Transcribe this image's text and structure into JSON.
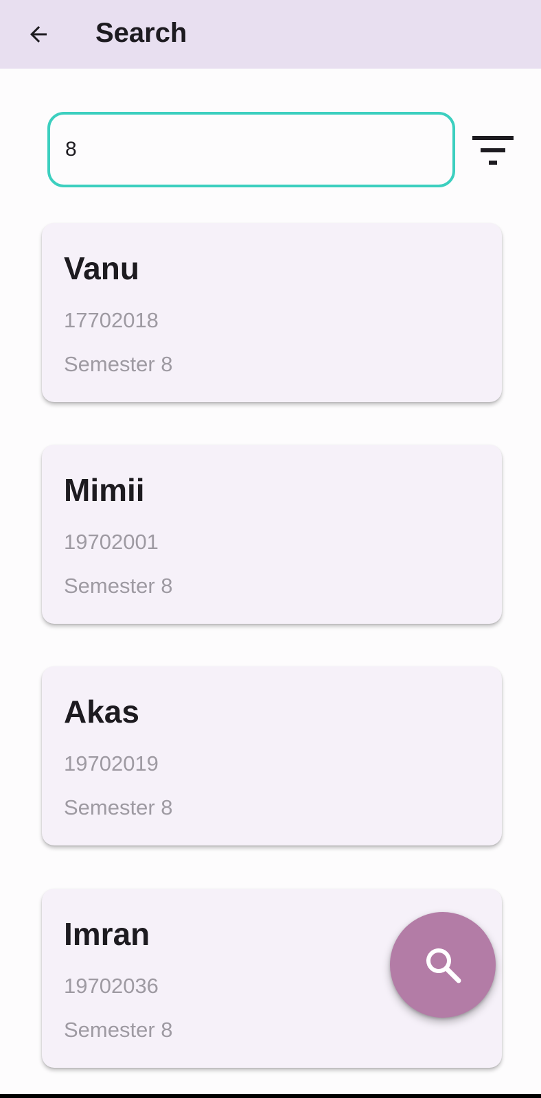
{
  "app_bar": {
    "title": "Search",
    "back_icon": "arrow-back-icon",
    "background": "#e8dff0"
  },
  "search": {
    "value": "8",
    "placeholder": "",
    "border_color": "#3ccfbf",
    "filter_icon": "filter-list-icon"
  },
  "results": [
    {
      "name": "Vanu",
      "id": "17702018",
      "semester": "Semester 8"
    },
    {
      "name": "Mimii",
      "id": "19702001",
      "semester": "Semester 8"
    },
    {
      "name": "Akas",
      "id": "19702019",
      "semester": "Semester 8"
    },
    {
      "name": "Imran",
      "id": "19702036",
      "semester": "Semester 8"
    }
  ],
  "fab": {
    "icon": "search-icon",
    "color": "#b37ca6"
  }
}
